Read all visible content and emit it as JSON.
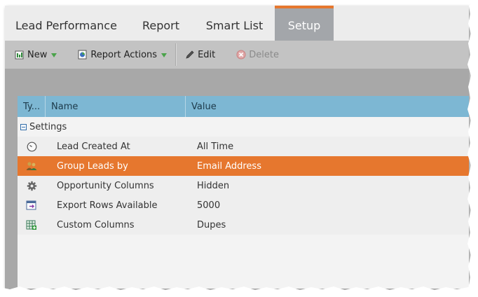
{
  "tabs": [
    {
      "label": "Lead Performance"
    },
    {
      "label": "Report"
    },
    {
      "label": "Smart List"
    },
    {
      "label": "Setup"
    }
  ],
  "active_tab": "Setup",
  "toolbar": {
    "new_label": "New",
    "report_actions_label": "Report Actions",
    "edit_label": "Edit",
    "delete_label": "Delete"
  },
  "grid": {
    "columns": {
      "type": "Ty...",
      "name": "Name",
      "value": "Value"
    },
    "group": "Settings",
    "rows": [
      {
        "icon": "clock-icon",
        "name": "Lead Created At",
        "value": "All Time"
      },
      {
        "icon": "group-users-icon",
        "name": "Group Leads by",
        "value": "Email Address"
      },
      {
        "icon": "gear-icon",
        "name": "Opportunity Columns",
        "value": "Hidden"
      },
      {
        "icon": "export-rows-icon",
        "name": "Export Rows Available",
        "value": "5000"
      },
      {
        "icon": "custom-columns-icon",
        "name": "Custom Columns",
        "value": "Dupes"
      }
    ]
  },
  "colors": {
    "accent": "#e6772e",
    "header": "#7db7d3",
    "active_tab": "#a3a6aa"
  }
}
